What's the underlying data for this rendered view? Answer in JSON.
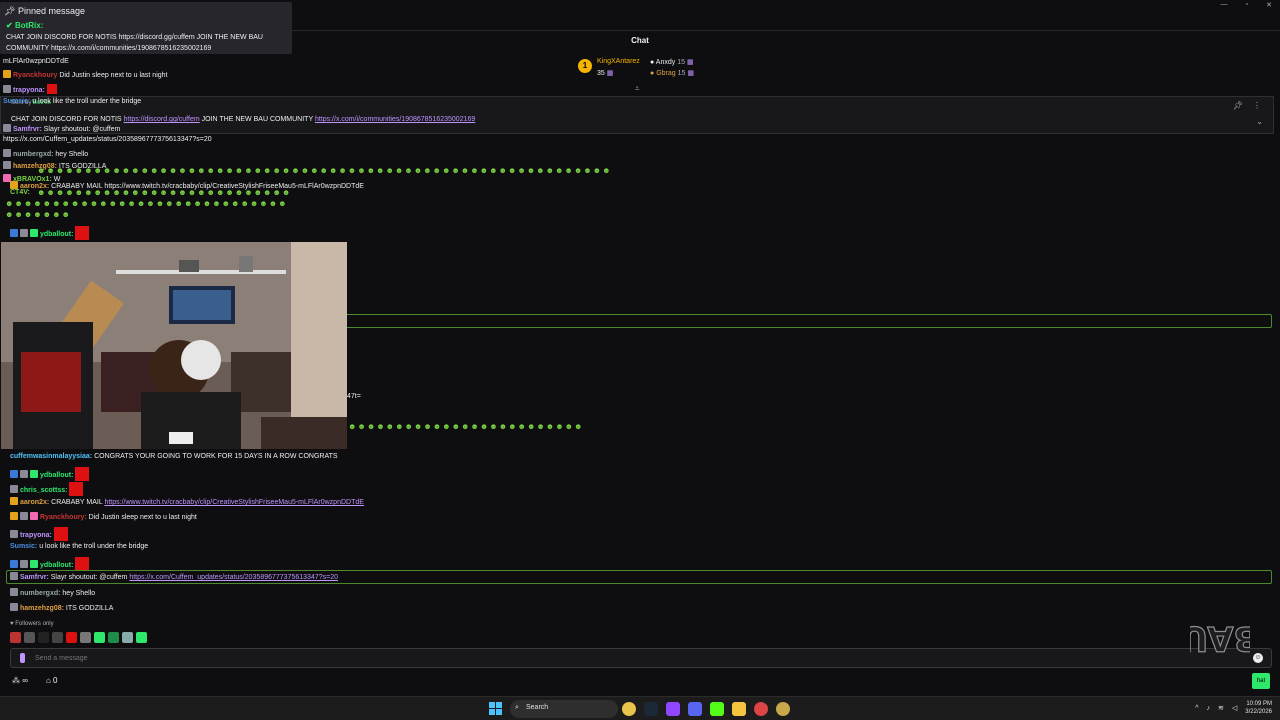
{
  "window": {
    "minimize": "—",
    "maximize": "▫",
    "close": "✕"
  },
  "header": {
    "title": "Chat"
  },
  "leaderboard": {
    "rank_badge": "1",
    "first": {
      "name": "KingXAntarez",
      "count": "35"
    },
    "second": {
      "name": "Anxdy",
      "count": "15"
    },
    "third": {
      "name": "Gbrag",
      "count": "15"
    }
  },
  "pinned": {
    "sent_by_label": "Sent by",
    "sent_by_user": "BotRix",
    "text_prefix": "CHAT JOIN DISCORD FOR NOTIS",
    "discord_url": "https://discord.gg/cuffem",
    "text_middle": "JOIN THE NEW BAU COMMUNITY",
    "community_url": "https://x.com/i/communities/1908678516235002169"
  },
  "overlay": {
    "title": "Pinned message",
    "user": "BotRix:",
    "text": "CHAT JOIN DISCORD FOR NOTIS https://discord.gg/cuffem JOIN THE NEW BAU COMMUNITY https://x.com/i/communities/1908678516235002169",
    "top_fragment": "ROW CONGRATS"
  },
  "ghost_messages": [
    {
      "text": "mLFlAr0wzpnDDTdE",
      "color": "#efeff1"
    },
    {
      "user": "Ryanckhoury",
      "text": "Did Justin sleep next to u last night",
      "color": "#c43535"
    },
    {
      "user": "trapyona:",
      "text": "",
      "color": "#bf94ff"
    },
    {
      "user": "Sumsic:",
      "text": "u look like the troll under the bridge",
      "color": "#4a90e2"
    },
    {
      "user": "Samfrvr:",
      "text": "Slayr shoutout: @cuffem",
      "color": "#bf94ff"
    },
    {
      "text": "https://x.com/Cuffem_updates/status/2035896777375613347?s=20",
      "color": "#efeff1"
    },
    {
      "user": "numbergxd:",
      "text": "hey Shello",
      "color": "#9aa"
    },
    {
      "user": "hamzehzg08:",
      "text": "ITS GODZILLA",
      "color": "#e0a040"
    },
    {
      "user": "aaron2x:",
      "text": "CRABABY MAIL https://www.twitch.tv/cracbaby/clip/CreativeStylishFriseeMau5-mLFlAr0wzpnDDTdE",
      "color": "#e0a040"
    },
    {
      "user": "CT4V:",
      "text": "",
      "color": "#7bd143"
    },
    {
      "user": "xBRAVOx1:",
      "text": "W",
      "color": "#7bd143"
    }
  ],
  "messages": [
    {
      "user": "ydballout:",
      "text": "",
      "color": "#2ee86b"
    },
    {
      "user": "cuffemwasinmalayysiaa:",
      "text": "CONGRATS YOUR GOING TO WORK FOR 15 DAYS IN A ROW CONGRATS",
      "color": "#4fc3f7"
    },
    {
      "user": "ydballout:",
      "text": "",
      "color": "#2ee86b"
    },
    {
      "user": "chris_scottss:",
      "text": "",
      "color": "#2ee86b"
    },
    {
      "user": "aaron2x:",
      "text": "CRABABY MAIL",
      "link": "https://www.twitch.tv/cracbaby/clip/CreativeStylishFriseeMau5-mLFlAr0wzpnDDTdE",
      "color": "#e0a040"
    },
    {
      "user": "Ryanckhoury:",
      "text": "Did Justin sleep next to u last night",
      "color": "#c43535"
    },
    {
      "user": "trapyona:",
      "text": "",
      "color": "#bf94ff"
    },
    {
      "user": "Sumsic:",
      "text": "u look like the troll under the bridge",
      "color": "#4a90e2"
    },
    {
      "user": "ydballout:",
      "text": "",
      "color": "#2ee86b"
    },
    {
      "user": "Samfrvr:",
      "text": "Slayr shoutout: @cuffem",
      "link": "https://x.com/Cuffem_updates/status/2035896777375613347?s=20",
      "color": "#bf94ff"
    },
    {
      "user": "numbergxd:",
      "text": "hey Shello",
      "color": "#9aa"
    },
    {
      "user": "hamzehzg08:",
      "text": "ITS GODZILLA",
      "color": "#e0a040"
    }
  ],
  "url_fragment": "47t=",
  "footer": {
    "followers_only": "Followers only",
    "input_placeholder": "Send a message",
    "infinity": "∞",
    "gift_count": "0",
    "send_label": "hat"
  },
  "taskbar": {
    "search_label": "Search",
    "time": "10:09 PM",
    "date": "3/22/2026"
  },
  "watermark": "BAU",
  "colors": {
    "accent": "#bf94ff",
    "highlight_border": "#4d8a2e",
    "emote_red": "#dd1111",
    "green": "#2ee86b"
  }
}
